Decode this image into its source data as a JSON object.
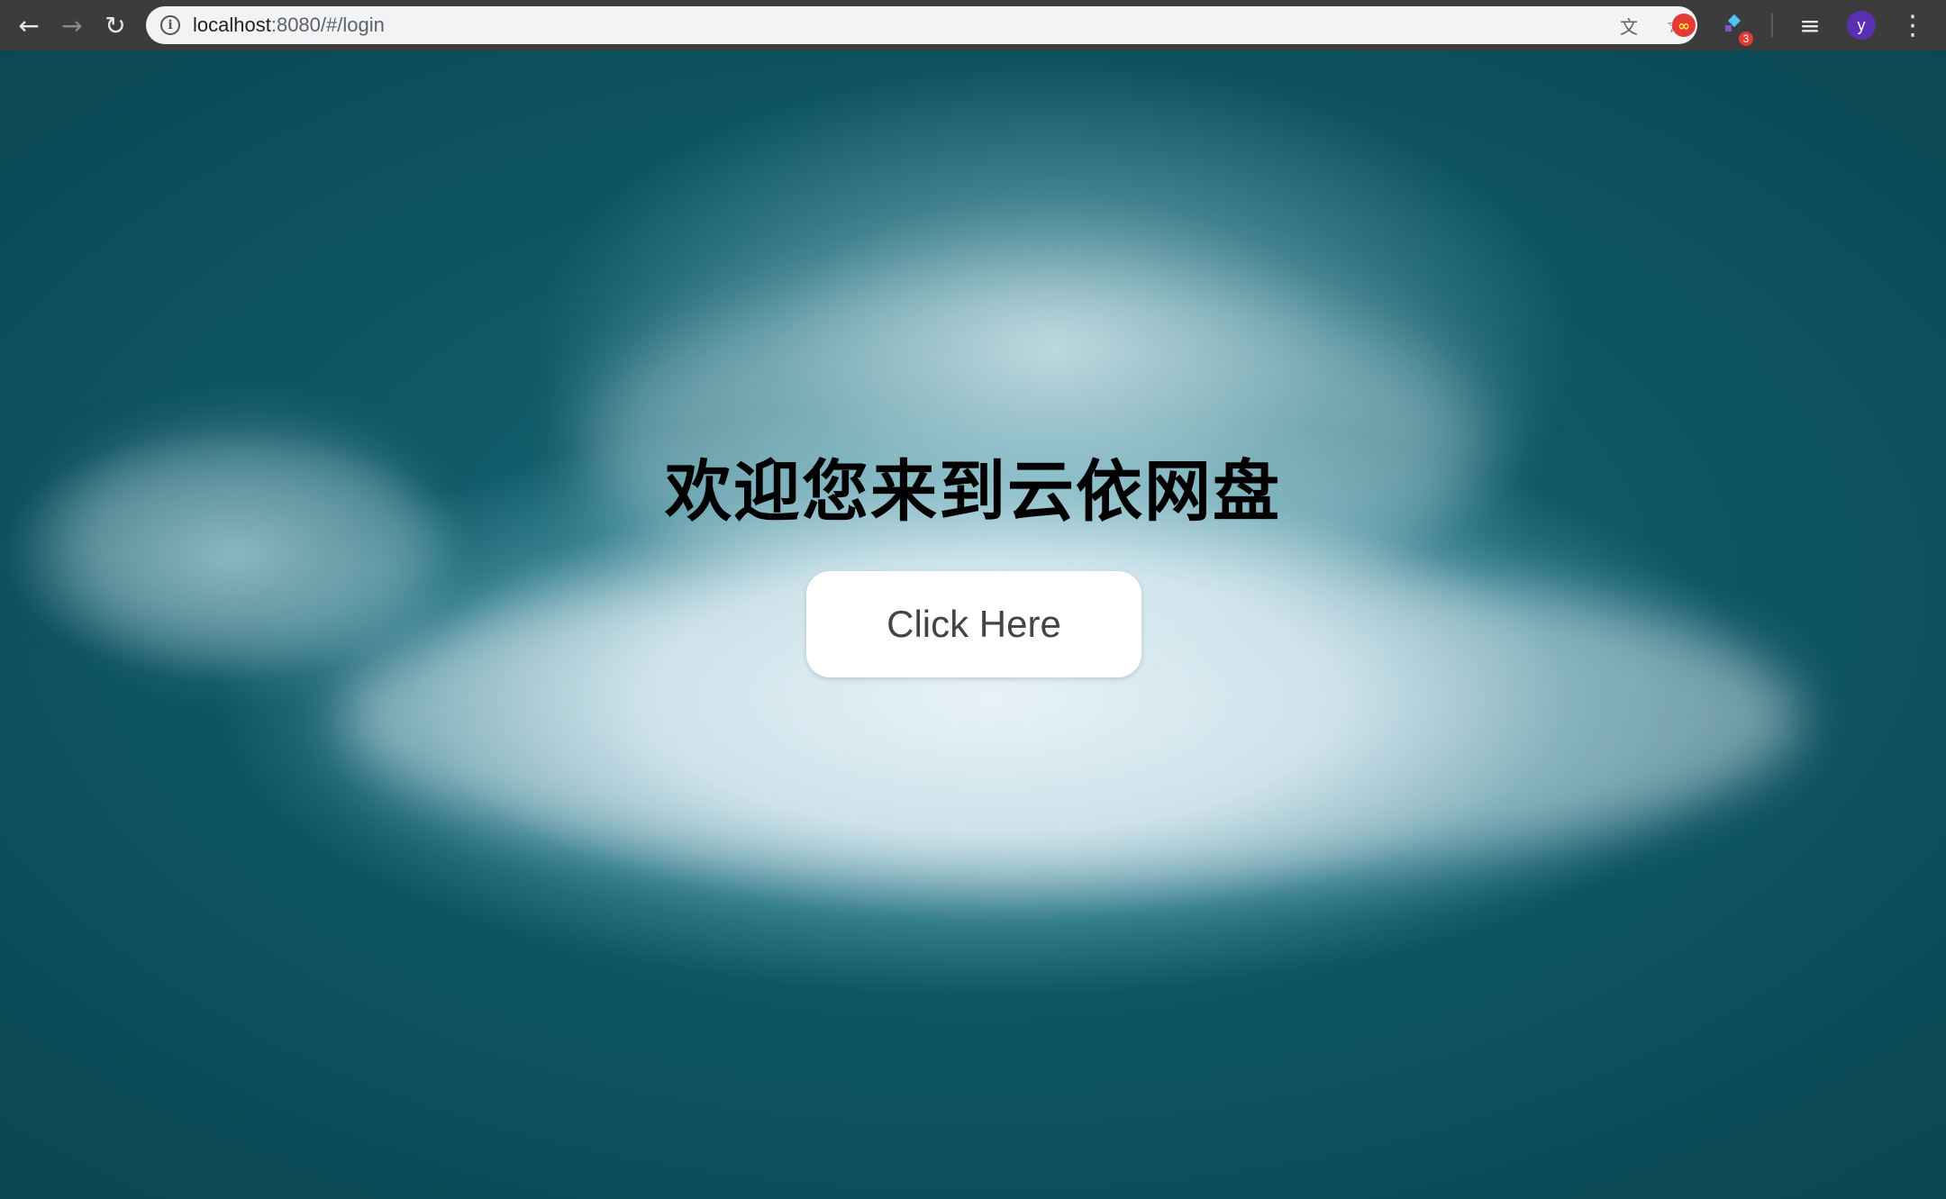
{
  "browser": {
    "url_host": "localhost",
    "url_rest": ":8080/#/login",
    "avatar_letter": "y",
    "extension_badge": "3",
    "ext_red_symbol": "∞",
    "icons": {
      "back": "←",
      "forward": "→",
      "reload": "↻",
      "translate": "文",
      "bookmark": "☆",
      "menu": "⋮",
      "playlist": "≡"
    }
  },
  "page": {
    "headline": "欢迎您来到云依网盘",
    "button_label": "Click Here"
  },
  "colors": {
    "ocean": "#0f5866",
    "foam": "#ebf5fa",
    "button_bg": "#ffffff",
    "headline": "#000000",
    "avatar": "#5b2fb3"
  }
}
